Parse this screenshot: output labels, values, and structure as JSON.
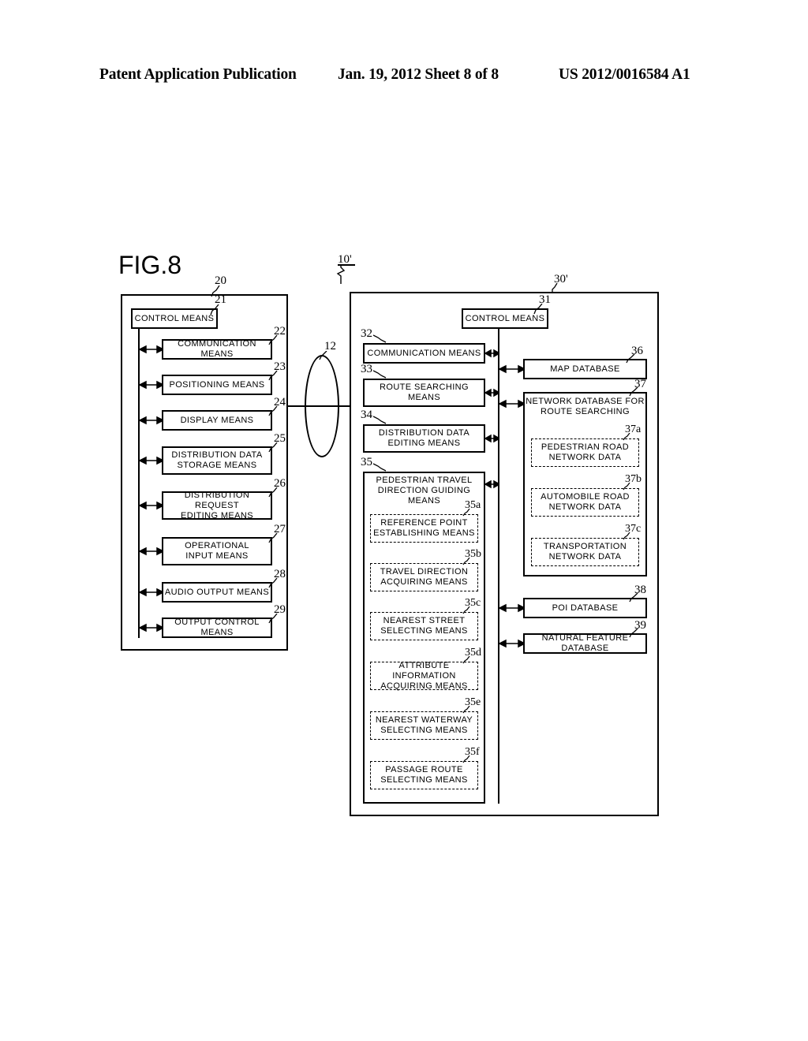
{
  "header": {
    "publication": "Patent Application Publication",
    "date_sheet": "Jan. 19, 2012  Sheet 8 of 8",
    "patent_number": "US 2012/0016584 A1"
  },
  "figure": {
    "label": "FIG.8"
  },
  "terminal": {
    "ref": "20",
    "control": {
      "ref": "21",
      "label": "CONTROL MEANS"
    },
    "units": [
      {
        "ref": "22",
        "label": "COMMUNICATION MEANS"
      },
      {
        "ref": "23",
        "label": "POSITIONING MEANS"
      },
      {
        "ref": "24",
        "label": "DISPLAY MEANS"
      },
      {
        "ref": "25",
        "label": "DISTRIBUTION DATA\nSTORAGE MEANS"
      },
      {
        "ref": "26",
        "label": "DISTRIBUTION REQUEST\nEDITING MEANS"
      },
      {
        "ref": "27",
        "label": "OPERATIONAL\nINPUT MEANS"
      },
      {
        "ref": "28",
        "label": "AUDIO OUTPUT MEANS"
      },
      {
        "ref": "29",
        "label": "OUTPUT CONTROL MEANS"
      }
    ]
  },
  "network": {
    "ref": "12"
  },
  "system": {
    "ref": "10'"
  },
  "server": {
    "ref": "30'",
    "control": {
      "ref": "31",
      "label": "CONTROL MEANS"
    },
    "units": [
      {
        "ref": "32",
        "label": "COMMUNICATION MEANS"
      },
      {
        "ref": "33",
        "label": "ROUTE SEARCHING\nMEANS"
      },
      {
        "ref": "34",
        "label": "DISTRIBUTION DATA\nEDITING MEANS"
      }
    ],
    "guiding": {
      "ref": "35",
      "label": "PEDESTRIAN TRAVEL\nDIRECTION GUIDING MEANS",
      "subunits": [
        {
          "ref": "35a",
          "label": "REFERENCE POINT\nESTABLISHING MEANS"
        },
        {
          "ref": "35b",
          "label": "TRAVEL DIRECTION\nACQUIRING MEANS"
        },
        {
          "ref": "35c",
          "label": "NEAREST STREET\nSELECTING MEANS"
        },
        {
          "ref": "35d",
          "label": "ATTRIBUTE INFORMATION\nACQUIRING MEANS"
        },
        {
          "ref": "35e",
          "label": "NEAREST WATERWAY\nSELECTING MEANS"
        },
        {
          "ref": "35f",
          "label": "PASSAGE ROUTE\nSELECTING MEANS"
        }
      ]
    },
    "databases": [
      {
        "ref": "36",
        "label": "MAP DATABASE"
      },
      {
        "ref": "38",
        "label": "POI DATABASE"
      },
      {
        "ref": "39",
        "label": "NATURAL FEATURE DATABASE"
      }
    ],
    "network_db": {
      "ref": "37",
      "label": "NETWORK DATABASE FOR\nROUTE SEARCHING",
      "subunits": [
        {
          "ref": "37a",
          "label": "PEDESTRIAN ROAD\nNETWORK DATA"
        },
        {
          "ref": "37b",
          "label": "AUTOMOBILE ROAD\nNETWORK DATA"
        },
        {
          "ref": "37c",
          "label": "TRANSPORTATION\nNETWORK DATA"
        }
      ]
    }
  },
  "colors": {
    "ink": "#000000",
    "paper": "#ffffff"
  }
}
